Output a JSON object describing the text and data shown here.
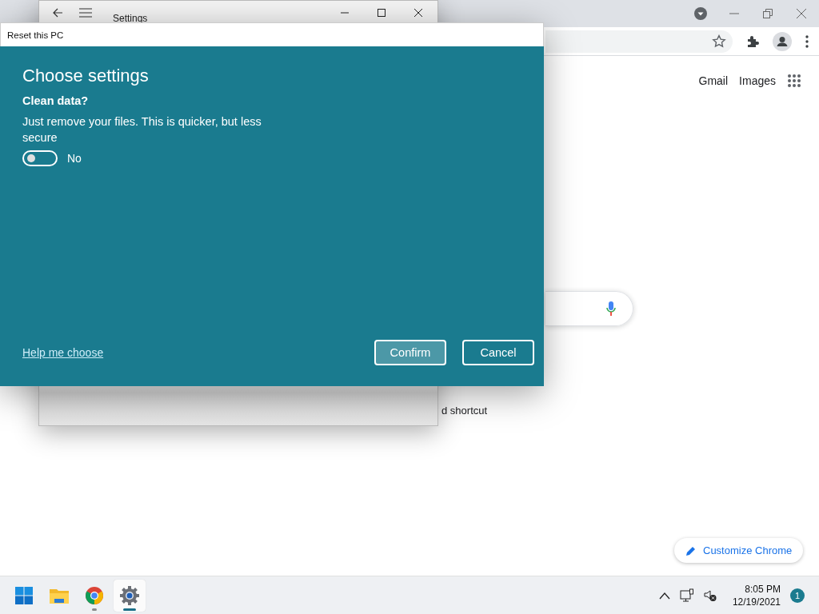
{
  "chrome": {
    "links": [
      {
        "label": "Gmail"
      },
      {
        "label": "Images"
      }
    ],
    "shortcut_text": "d shortcut",
    "customize_button": "Customize Chrome"
  },
  "settings_window": {
    "title": "Settings"
  },
  "dialog": {
    "title": "Reset this PC",
    "heading": "Choose settings",
    "question": "Clean data?",
    "description": "Just remove your files. This is quicker, but less secure",
    "toggle": {
      "on": false,
      "label": "No"
    },
    "help_link": "Help me choose",
    "buttons": [
      {
        "label": "Confirm",
        "kind": "primary"
      },
      {
        "label": "Cancel",
        "kind": "secondary"
      }
    ]
  },
  "taskbar": {
    "apps": [
      {
        "kind": "start",
        "running": false,
        "selected": false
      },
      {
        "kind": "explorer",
        "running": false,
        "selected": false
      },
      {
        "kind": "chrome",
        "running": true,
        "selected": false
      },
      {
        "kind": "settings",
        "running": true,
        "selected": true
      }
    ],
    "time": "8:05 PM",
    "date": "12/19/2021",
    "notification_count": "1"
  }
}
